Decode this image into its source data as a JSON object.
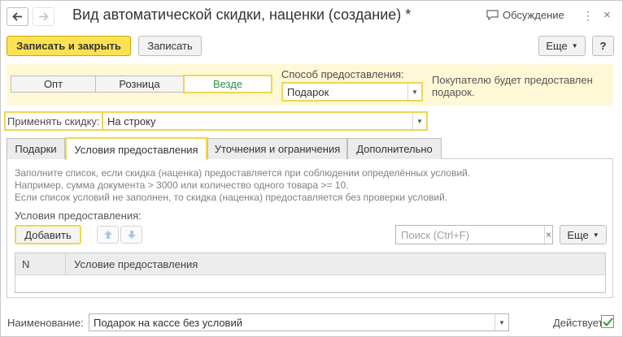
{
  "window": {
    "title": "Вид автоматической скидки, наценки (создание) *",
    "discussion_label": "Обсуждение"
  },
  "toolbar": {
    "save_close_label": "Записать и закрыть",
    "save_label": "Записать",
    "more_label": "Еще",
    "help_label": "?"
  },
  "segments": {
    "items": [
      "Опт",
      "Розница",
      "Везде"
    ],
    "selected": "Везде"
  },
  "provision": {
    "label": "Способ предоставления:",
    "value": "Подарок",
    "note": "Покупателю будет предоставлен подарок."
  },
  "apply": {
    "label": "Применять скидку:",
    "value": "На строку"
  },
  "tabs": [
    "Подарки",
    "Условия предоставления",
    "Уточнения и ограничения",
    "Дополнительно"
  ],
  "active_tab": "Условия предоставления",
  "conditions": {
    "info_lines": [
      "Заполните список, если скидка (наценка) предоставляется при соблюдении определённых условий.",
      "Например, сумма документа > 3000 или количество одного товара >= 10.",
      "Если список условий не заполнен, то скидка (наценка) предоставляется без проверки условий."
    ],
    "list_label": "Условия предоставления:",
    "add_label": "Добавить",
    "search_placeholder": "Поиск (Ctrl+F)",
    "more_label": "Еще",
    "columns": [
      "N",
      "Условие предоставления"
    ],
    "rows": []
  },
  "footer": {
    "name_label": "Наименование:",
    "name_value": "Подарок на кассе без условий",
    "active_label": "Действует:",
    "active_checked": true
  },
  "colors": {
    "primary_button": "#fce253",
    "focus_border": "#f1d64e",
    "active_segment_text": "#2f8f3f",
    "panel_background": "#fff8d6"
  }
}
